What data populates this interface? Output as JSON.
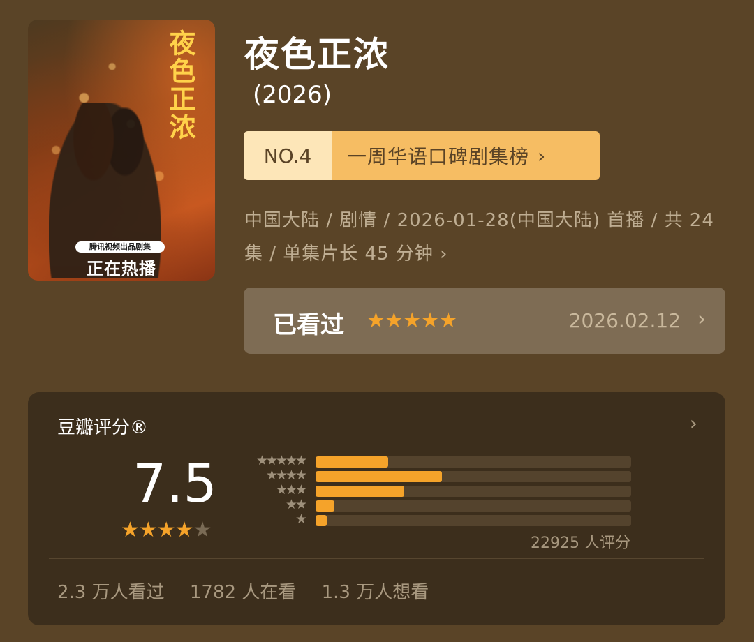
{
  "show": {
    "title": "夜色正浓",
    "year": "(2026)",
    "poster": {
      "title": "夜色正浓",
      "badge": "腾讯视频出品剧集",
      "status": "正在热播"
    },
    "rank": {
      "number": "NO.4",
      "list_name": "一周华语口碑剧集榜"
    },
    "meta": "中国大陆 / 剧情 / 2026-01-28(中国大陆) 首播 / 共 24 集 / 单集片长 45 分钟"
  },
  "user_status": {
    "label": "已看过",
    "stars": "★★★★★",
    "rating": 5,
    "date": "2026.02.12"
  },
  "douban": {
    "label": "豆瓣评分®",
    "score": "7.5",
    "score_stars_on": "★★★★",
    "score_stars_off": "★",
    "distribution": [
      {
        "stars": "★★★★★",
        "percent": 23
      },
      {
        "stars": "★★★★",
        "percent": 40
      },
      {
        "stars": "★★★",
        "percent": 28
      },
      {
        "stars": "★★",
        "percent": 6
      },
      {
        "stars": "★",
        "percent": 3.5
      }
    ],
    "rating_count": "22925 人评分",
    "stats": [
      "2.3 万人看过",
      "1782 人在看",
      "1.3 万人想看"
    ]
  },
  "colors": {
    "background": "#5a4427",
    "accent": "#f5a32a",
    "card": "#3c2e1c"
  },
  "icons": {
    "chevron": "chevron-right-icon",
    "star": "star-icon"
  }
}
